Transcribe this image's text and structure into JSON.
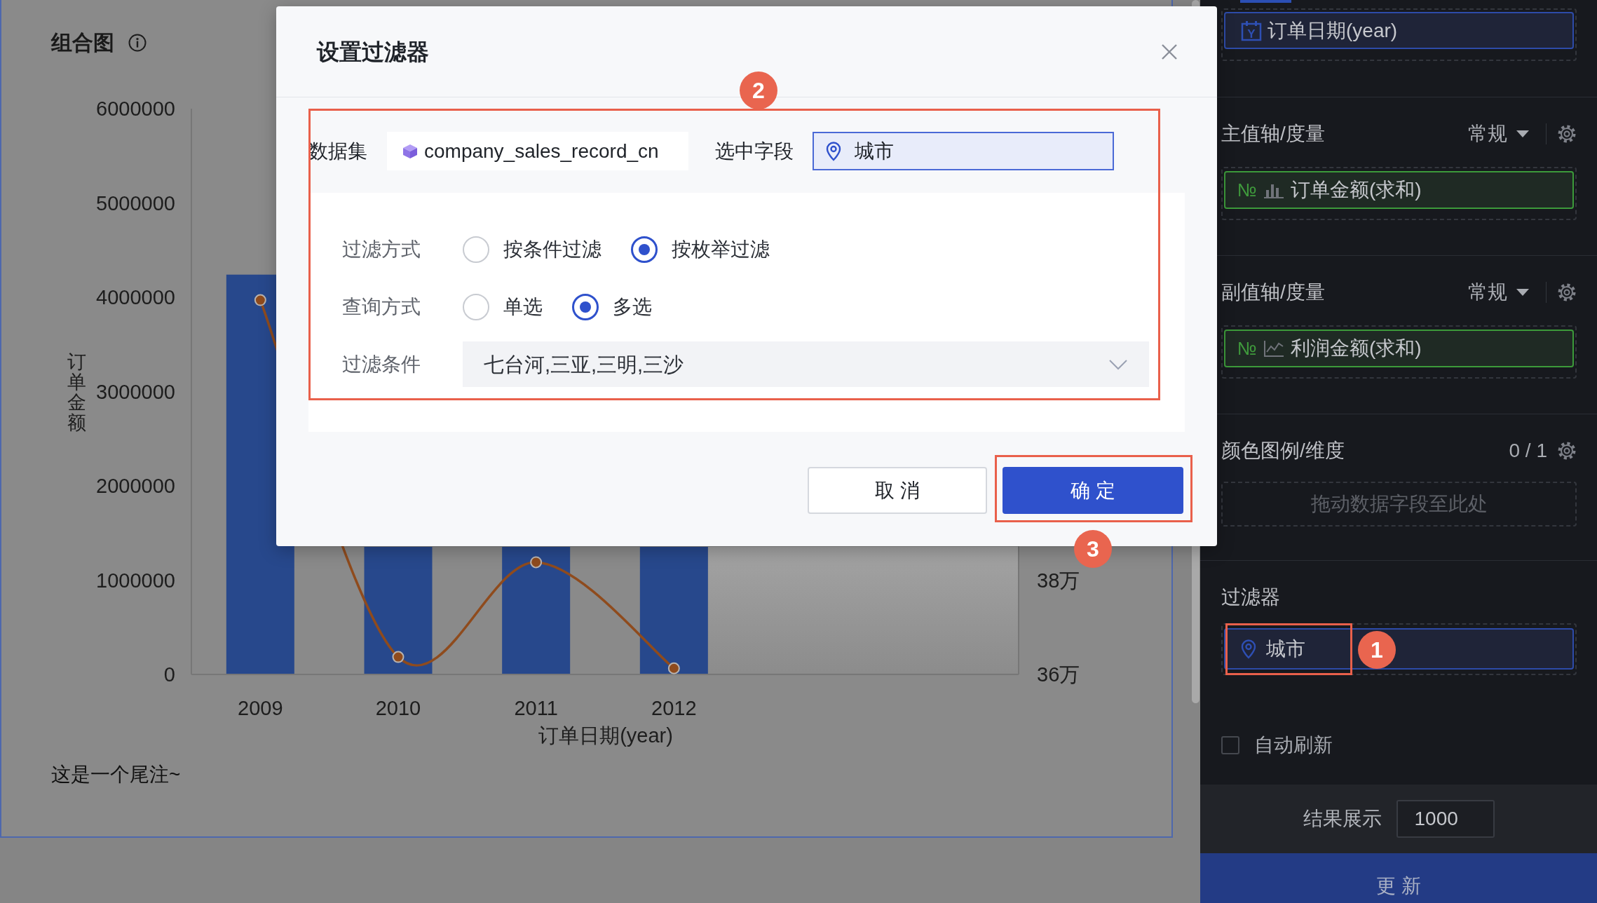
{
  "chart_card": {
    "title": "组合图",
    "bar_chart": {
      "chart_data": {
        "type": "bar",
        "xlabel": "订单日期(year)",
        "ylabel": "订单金额",
        "categories": [
          "2009",
          "2010",
          "2011",
          "2012"
        ],
        "values": [
          4240000,
          null,
          null,
          null
        ],
        "ylim": [
          0,
          6000000
        ],
        "yticks": [
          0,
          1000000,
          2000000,
          3000000,
          4000000,
          5000000,
          6000000
        ]
      }
    },
    "line_chart": {
      "chart_data": {
        "type": "line",
        "marker": true,
        "categories": [
          null,
          null,
          null,
          null,
          null,
          null
        ],
        "values": [
          43.94,
          36.37,
          38.38,
          36.13,
          null,
          null
        ],
        "ylim": [
          36,
          48
        ],
        "yticks": [
          {
            "value": 36,
            "label": "36万"
          },
          {
            "value": 38,
            "label": "38万"
          }
        ]
      }
    },
    "footnote": "这是一个尾注~"
  },
  "dialog": {
    "title": "设置过滤器",
    "dataset": {
      "label": "数据集",
      "value": "company_sales_record_cn"
    },
    "field": {
      "label": "选中字段",
      "value": "城市"
    },
    "filter_mode": {
      "label": "过滤方式",
      "options": [
        {
          "label": "按条件过滤",
          "selected": false
        },
        {
          "label": "按枚举过滤",
          "selected": true
        }
      ]
    },
    "query_mode": {
      "label": "查询方式",
      "options": [
        {
          "label": "单选",
          "selected": false
        },
        {
          "label": "多选",
          "selected": true
        }
      ]
    },
    "condition": {
      "label": "过滤条件",
      "value": "七台河,三亚,三明,三沙"
    },
    "buttons": [
      {
        "kind": "secondary",
        "label": "取 消"
      },
      {
        "kind": "primary",
        "label": "确 定"
      }
    ]
  },
  "side_panel": {
    "dimension_pill": {
      "badge": "Y",
      "label": "订单日期(year)"
    },
    "sections": [
      {
        "kind": "measure",
        "title": "主值轴/度量",
        "mode": "常规",
        "pill": {
          "type_symbol": "№",
          "label": "订单金额(求和)"
        }
      },
      {
        "kind": "measure",
        "title": "副值轴/度量",
        "mode": "常规",
        "pill": {
          "type_symbol": "№",
          "label": "利润金额(求和)"
        }
      },
      {
        "kind": "legend",
        "title": "颜色图例/维度",
        "count": "0 / 1",
        "drop_hint": "拖动数据字段至此处"
      },
      {
        "kind": "filter",
        "title": "过滤器",
        "pill": {
          "label": "城市"
        }
      }
    ],
    "auto_refresh": {
      "label": "自动刷新",
      "checked": false
    },
    "result_limit": {
      "label": "结果展示",
      "value": "1000"
    },
    "update_button": "更 新"
  },
  "callouts": [
    {
      "number": "1"
    },
    {
      "number": "2"
    },
    {
      "number": "3"
    }
  ]
}
